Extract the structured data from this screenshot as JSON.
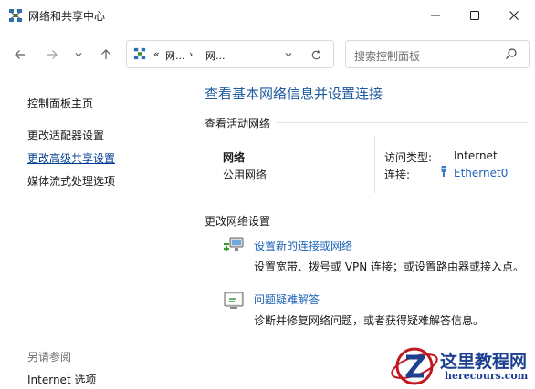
{
  "window": {
    "title": "网络和共享中心",
    "icon": "network-center-icon"
  },
  "nav": {
    "breadcrumb": {
      "overflow": "«",
      "items": [
        "网...",
        "网..."
      ],
      "separator": "›"
    },
    "search": {
      "placeholder": "搜索控制面板"
    }
  },
  "sidebar": {
    "items": [
      {
        "label": "控制面板主页"
      },
      {
        "label": "更改适配器设置"
      },
      {
        "label": "更改高级共享设置"
      },
      {
        "label": "媒体流式处理选项"
      }
    ],
    "see_also": {
      "heading": "另请参阅",
      "items": [
        {
          "label": "Internet 选项"
        }
      ]
    }
  },
  "main": {
    "title": "查看基本网络信息并设置连接",
    "active_networks": {
      "heading": "查看活动网络",
      "network_name": "网络",
      "network_profile": "公用网络",
      "access_type_label": "访问类型:",
      "access_type_value": "Internet",
      "connection_label": "连接:",
      "connection_value": "Ethernet0"
    },
    "change_settings": {
      "heading": "更改网络设置",
      "items": [
        {
          "title": "设置新的连接或网络",
          "desc": "设置宽带、拨号或 VPN 连接；或设置路由器或接入点。"
        },
        {
          "title": "问题疑难解答",
          "desc": "诊断并修复网络问题，或者获得疑难解答信息。"
        }
      ]
    }
  },
  "watermark": {
    "title": "这里教程网",
    "url": "herecours.com"
  },
  "colors": {
    "link": "#1e63b6",
    "heading": "#1e5a9e",
    "watermark_red": "#c0181e",
    "watermark_blue": "#1c3f8f"
  }
}
